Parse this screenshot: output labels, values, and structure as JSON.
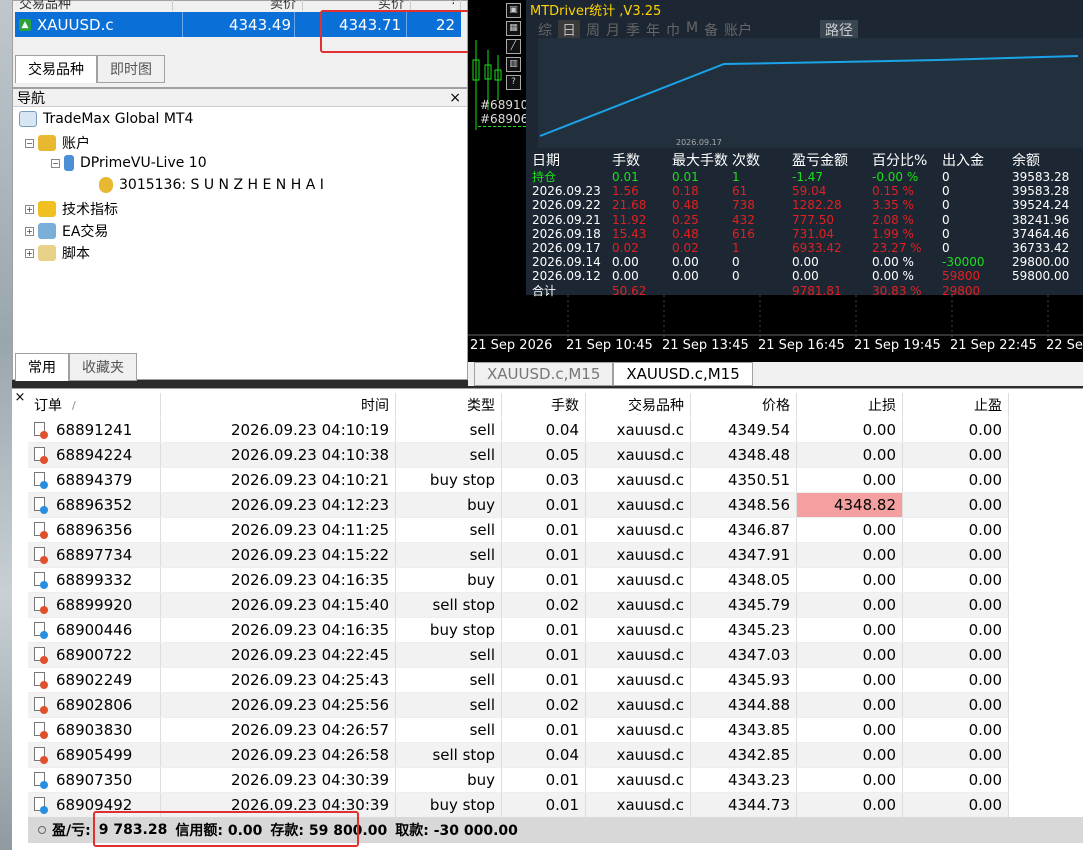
{
  "market_watch": {
    "headers": [
      "交易品种",
      "卖价",
      "买价",
      "!"
    ],
    "symbol": "XAUUSD.c",
    "bid": "4343.49",
    "ask": "4343.71",
    "spread": "22",
    "tabs": [
      "交易品种",
      "即时图"
    ]
  },
  "navigator": {
    "title": "导航",
    "close": "×",
    "root": "TradeMax Global MT4",
    "accounts": "账户",
    "server": "DPrimeVU-Live 10",
    "account": "3015136: S U N Z H E N H A I",
    "indicators": "技术指标",
    "experts": "EA交易",
    "scripts": "脚本",
    "tabs": [
      "常用",
      "收藏夹"
    ]
  },
  "stats": {
    "title": "MTDriver统计 ,V3.25",
    "menu": [
      "综",
      "日",
      "周",
      "月",
      "季",
      "年",
      "巾",
      "M",
      "备",
      "账户"
    ],
    "active_menu": "日",
    "route": "路径",
    "chart_date_label": "2026.09.17",
    "order_labels": [
      "#68910",
      "#68906"
    ],
    "columns": [
      "日期",
      "手数",
      "最大手数",
      "次数",
      "盈亏金额",
      "百分比%",
      "出入金",
      "余额"
    ],
    "rows": [
      {
        "date": "持仓",
        "lots": "0.01",
        "max": "0.01",
        "count": "1",
        "pl": "-1.47",
        "pct": "-0.00 %",
        "io": "0",
        "bal": "39583.28",
        "color": "#19e019"
      },
      {
        "date": "2026.09.23",
        "lots": "1.56",
        "max": "0.18",
        "count": "61",
        "pl": "59.04",
        "pct": "0.15 %",
        "io": "0",
        "bal": "39583.28",
        "color": "#e02020"
      },
      {
        "date": "2026.09.22",
        "lots": "21.68",
        "max": "0.48",
        "count": "738",
        "pl": "1282.28",
        "pct": "3.35 %",
        "io": "0",
        "bal": "39524.24",
        "color": "#e02020"
      },
      {
        "date": "2026.09.21",
        "lots": "11.92",
        "max": "0.25",
        "count": "432",
        "pl": "777.50",
        "pct": "2.08 %",
        "io": "0",
        "bal": "38241.96",
        "color": "#e02020"
      },
      {
        "date": "2026.09.18",
        "lots": "15.43",
        "max": "0.48",
        "count": "616",
        "pl": "731.04",
        "pct": "1.99 %",
        "io": "0",
        "bal": "37464.46",
        "color": "#e02020"
      },
      {
        "date": "2026.09.17",
        "lots": "0.02",
        "max": "0.02",
        "count": "1",
        "pl": "6933.42",
        "pct": "23.27 %",
        "io": "0",
        "bal": "36733.42",
        "color": "#e02020"
      },
      {
        "date": "2026.09.14",
        "lots": "0.00",
        "max": "0.00",
        "count": "0",
        "pl": "0.00",
        "pct": "0.00 %",
        "io": "-30000",
        "bal": "29800.00",
        "color": "#ffffff",
        "io_color": "#19e019"
      },
      {
        "date": "2026.09.12",
        "lots": "0.00",
        "max": "0.00",
        "count": "0",
        "pl": "0.00",
        "pct": "0.00 %",
        "io": "59800",
        "bal": "59800.00",
        "color": "#ffffff",
        "io_color": "#e02020"
      },
      {
        "date": "合计",
        "lots": "50.62",
        "max": "",
        "count": "",
        "pl": "9781.81",
        "pct": "30.83 %",
        "io": "29800",
        "bal": "",
        "color": "#e02020"
      }
    ],
    "curve": [
      0,
      0.8,
      0.83,
      0.86,
      0.9,
      0.94,
      0.97,
      1.0
    ]
  },
  "time_axis": [
    "21 Sep 2026",
    "21 Sep 10:45",
    "21 Sep 13:45",
    "21 Sep 16:45",
    "21 Sep 19:45",
    "21 Sep 22:45",
    "22 Sep"
  ],
  "chart_tabs": [
    "XAUUSD.c,M15",
    "XAUUSD.c,M15"
  ],
  "trade": {
    "columns": [
      "订单",
      "时间",
      "类型",
      "手数",
      "交易品种",
      "价格",
      "止损",
      "止盈"
    ],
    "sort_marker": "/",
    "rows": [
      {
        "order": "68891241",
        "time": "2026.09.23 04:10:19",
        "type": "sell",
        "lots": "0.04",
        "symbol": "xauusd.c",
        "price": "4349.54",
        "sl": "0.00",
        "tp": "0.00"
      },
      {
        "order": "68894224",
        "time": "2026.09.23 04:10:38",
        "type": "sell",
        "lots": "0.05",
        "symbol": "xauusd.c",
        "price": "4348.48",
        "sl": "0.00",
        "tp": "0.00"
      },
      {
        "order": "68894379",
        "time": "2026.09.23 04:10:21",
        "type": "buy stop",
        "lots": "0.03",
        "symbol": "xauusd.c",
        "price": "4350.51",
        "sl": "0.00",
        "tp": "0.00"
      },
      {
        "order": "68896352",
        "time": "2026.09.23 04:12:23",
        "type": "buy",
        "lots": "0.01",
        "symbol": "xauusd.c",
        "price": "4348.56",
        "sl": "4348.82",
        "tp": "0.00",
        "sl_highlight": true
      },
      {
        "order": "68896356",
        "time": "2026.09.23 04:11:25",
        "type": "sell",
        "lots": "0.01",
        "symbol": "xauusd.c",
        "price": "4346.87",
        "sl": "0.00",
        "tp": "0.00"
      },
      {
        "order": "68897734",
        "time": "2026.09.23 04:15:22",
        "type": "sell",
        "lots": "0.01",
        "symbol": "xauusd.c",
        "price": "4347.91",
        "sl": "0.00",
        "tp": "0.00"
      },
      {
        "order": "68899332",
        "time": "2026.09.23 04:16:35",
        "type": "buy",
        "lots": "0.01",
        "symbol": "xauusd.c",
        "price": "4348.05",
        "sl": "0.00",
        "tp": "0.00"
      },
      {
        "order": "68899920",
        "time": "2026.09.23 04:15:40",
        "type": "sell stop",
        "lots": "0.02",
        "symbol": "xauusd.c",
        "price": "4345.79",
        "sl": "0.00",
        "tp": "0.00"
      },
      {
        "order": "68900446",
        "time": "2026.09.23 04:16:35",
        "type": "buy stop",
        "lots": "0.01",
        "symbol": "xauusd.c",
        "price": "4345.23",
        "sl": "0.00",
        "tp": "0.00"
      },
      {
        "order": "68900722",
        "time": "2026.09.23 04:22:45",
        "type": "sell",
        "lots": "0.01",
        "symbol": "xauusd.c",
        "price": "4347.03",
        "sl": "0.00",
        "tp": "0.00"
      },
      {
        "order": "68902249",
        "time": "2026.09.23 04:25:43",
        "type": "sell",
        "lots": "0.01",
        "symbol": "xauusd.c",
        "price": "4345.93",
        "sl": "0.00",
        "tp": "0.00"
      },
      {
        "order": "68902806",
        "time": "2026.09.23 04:25:56",
        "type": "sell",
        "lots": "0.02",
        "symbol": "xauusd.c",
        "price": "4344.88",
        "sl": "0.00",
        "tp": "0.00"
      },
      {
        "order": "68903830",
        "time": "2026.09.23 04:26:57",
        "type": "sell",
        "lots": "0.01",
        "symbol": "xauusd.c",
        "price": "4343.85",
        "sl": "0.00",
        "tp": "0.00"
      },
      {
        "order": "68905499",
        "time": "2026.09.23 04:26:58",
        "type": "sell stop",
        "lots": "0.04",
        "symbol": "xauusd.c",
        "price": "4342.85",
        "sl": "0.00",
        "tp": "0.00"
      },
      {
        "order": "68907350",
        "time": "2026.09.23 04:30:39",
        "type": "buy",
        "lots": "0.01",
        "symbol": "xauusd.c",
        "price": "4343.23",
        "sl": "0.00",
        "tp": "0.00"
      },
      {
        "order": "68909492",
        "time": "2026.09.23 04:30:39",
        "type": "buy stop",
        "lots": "0.01",
        "symbol": "xauusd.c",
        "price": "4344.73",
        "sl": "0.00",
        "tp": "0.00"
      }
    ],
    "summary": {
      "label": "盈/亏:",
      "profit": "9 783.28",
      "credit": "信用额: 0.00",
      "deposit": "存款: 59 800.00",
      "withdraw": "取款: -30 000.00"
    }
  },
  "colors": {
    "sell_dot": "#e0502a",
    "buy_dot": "#2a8ee0",
    "highlight": "#f4a0a0",
    "curve": "#1aa3e8"
  }
}
